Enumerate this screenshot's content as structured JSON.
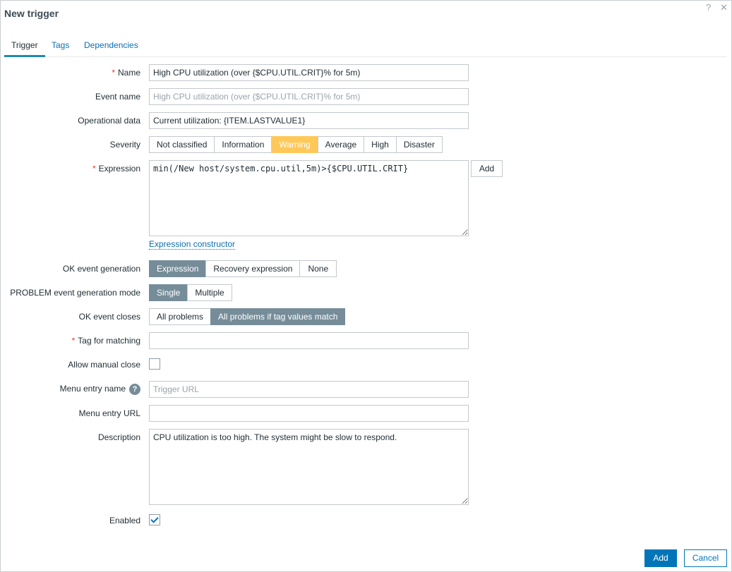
{
  "window": {
    "title": "New trigger",
    "help_icon": "?",
    "close_icon": "✕"
  },
  "tabs": [
    {
      "label": "Trigger",
      "active": true
    },
    {
      "label": "Tags",
      "active": false
    },
    {
      "label": "Dependencies",
      "active": false
    }
  ],
  "form": {
    "name": {
      "label": "Name",
      "required": true,
      "value": "High CPU utilization (over {$CPU.UTIL.CRIT}% for 5m)"
    },
    "event_name": {
      "label": "Event name",
      "placeholder": "High CPU utilization (over {$CPU.UTIL.CRIT}% for 5m)",
      "value": ""
    },
    "operational_data": {
      "label": "Operational data",
      "value": "Current utilization: {ITEM.LASTVALUE1}"
    },
    "severity": {
      "label": "Severity",
      "options": [
        "Not classified",
        "Information",
        "Warning",
        "Average",
        "High",
        "Disaster"
      ],
      "selected": "Warning"
    },
    "expression": {
      "label": "Expression",
      "required": true,
      "value": "min(/New host/system.cpu.util,5m)>{$CPU.UTIL.CRIT}",
      "add_label": "Add",
      "constructor_link": "Expression constructor"
    },
    "ok_event_generation": {
      "label": "OK event generation",
      "options": [
        "Expression",
        "Recovery expression",
        "None"
      ],
      "selected": "Expression"
    },
    "problem_mode": {
      "label": "PROBLEM event generation mode",
      "options": [
        "Single",
        "Multiple"
      ],
      "selected": "Single"
    },
    "ok_event_closes": {
      "label": "OK event closes",
      "options": [
        "All problems",
        "All problems if tag values match"
      ],
      "selected": "All problems if tag values match"
    },
    "tag_for_matching": {
      "label": "Tag for matching",
      "required": true,
      "value": ""
    },
    "allow_manual_close": {
      "label": "Allow manual close",
      "checked": false
    },
    "menu_entry_name": {
      "label": "Menu entry name",
      "help": "?",
      "placeholder": "Trigger URL",
      "value": ""
    },
    "menu_entry_url": {
      "label": "Menu entry URL",
      "value": ""
    },
    "description": {
      "label": "Description",
      "value": "CPU utilization is too high. The system might be slow to respond."
    },
    "enabled": {
      "label": "Enabled",
      "checked": true
    }
  },
  "footer": {
    "add_label": "Add",
    "cancel_label": "Cancel"
  },
  "colors": {
    "primary": "#0275b8",
    "warning": "#ffc859",
    "selected_segment": "#768d99",
    "required": "#e23b3b"
  }
}
